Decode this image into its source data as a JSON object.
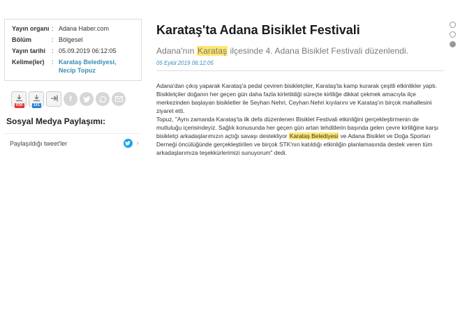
{
  "meta": {
    "rows": [
      {
        "key": "Yayın organı",
        "value": "Adana Haber.com"
      },
      {
        "key": "Bölüm",
        "value": "Bölgesel"
      },
      {
        "key": "Yayın tarihi",
        "value": "05.09.2019 06:12:05"
      }
    ],
    "keywords_label": "Kelime(ler)",
    "keywords_line1": "Karataş Belediyesi,",
    "keywords_line2": "Necip Topuz",
    "colon": ":"
  },
  "share_icons": [
    "download-pdf-icon",
    "download-1x1-icon",
    "export-icon",
    "facebook-icon",
    "twitter-icon",
    "whatsapp-icon",
    "email-icon"
  ],
  "badges": {
    "pdf": "PDF",
    "one": "1X1"
  },
  "social": {
    "title": "Sosyal Medya Paylaşımı:",
    "tweets_label": "Paylaşıldığı tweet'ler"
  },
  "article": {
    "title": "Karataş'ta Adana Bisiklet Festivali",
    "summary_pre": "Adana'nın ",
    "summary_hl": "Karataş",
    "summary_post": " ilçesinde 4. Adana Bisiklet Festivali düzenlendi.",
    "date": "05 Eylül 2019 06:12:05",
    "p1": "Adana'dan çıkış yaparak Karataş'a pedal çeviren bisikletçiler, Karataş'ta kamp kurarak çeşitli etkinlikler yaptı. Bisikletçiler doğanın her geçen gün daha fazla kirletildiği süreçte kirliliğe dikkat çekmek amacıyla ilçe merkezinden başlayan bisikletler ile Seyhan Nehri, Ceyhan Nehri kıyılarını ve Karataş'ın birçok mahallesini ziyaret etti.",
    "p2_pre": "Topuz, \"Aynı zamanda Karataş'ta ilk defa düzenlenen Bisiklet Festivali etkinliğini gerçekleştirmenin de mutluluğu içerisindeyiz. Sağlık konusunda her geçen gün artan tehditlerin başında gelen çevre kirliliğine karşı bisikletçi arkadaşlarımızın açtığı savaşı destekliyor ",
    "p2_hl": "Karataş Belediyesi",
    "p2_post": " ve Adana Bisiklet ve Doğa Sporları Derneği öncülüğünde gerçekleştirilen ve birçok STK'nın katıldığı etkinliğin planlamasında destek veren tüm arkadaşlarımıza teşekkürlerimizi sunuyorum\" dedi."
  }
}
